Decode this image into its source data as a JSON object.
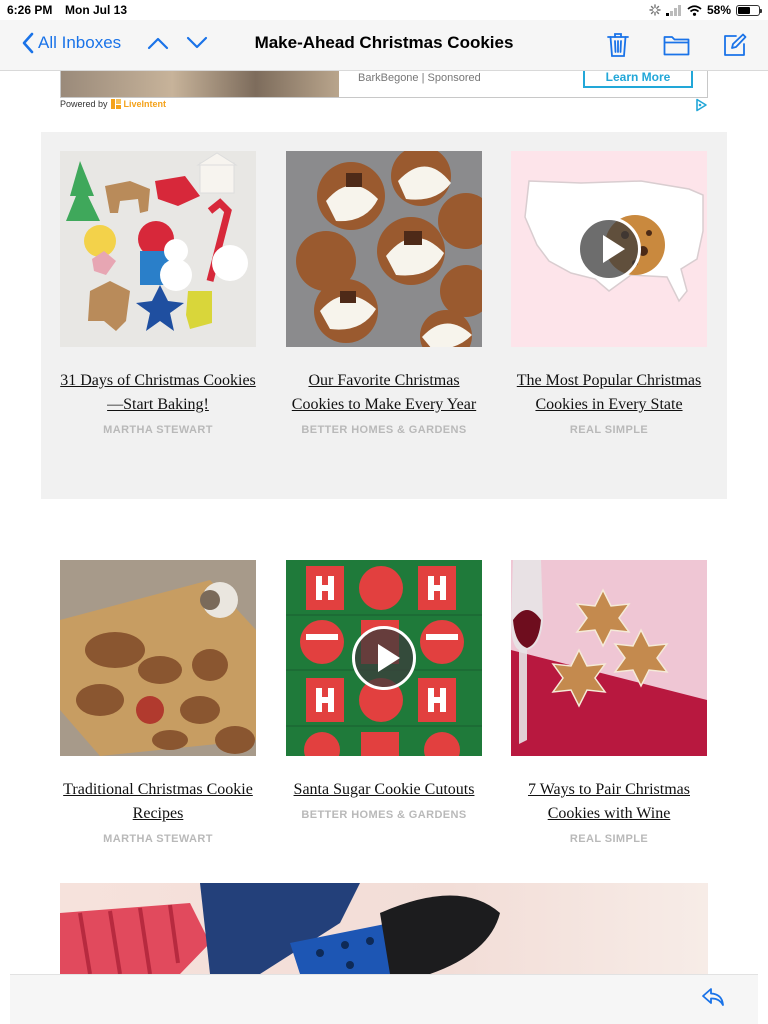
{
  "status": {
    "time": "6:26 PM",
    "date": "Mon Jul 13",
    "battery": "58%",
    "battery_level": 0.58
  },
  "nav": {
    "back_label": "All Inboxes",
    "title": "Make-Ahead Christmas Cookies",
    "icons": [
      "chevron-up-icon",
      "chevron-down-icon",
      "trash-icon",
      "folder-icon",
      "compose-icon"
    ]
  },
  "ad": {
    "sponsor": "BarkBegone | Sponsored",
    "cta": "Learn More",
    "powered_by": "Powered by",
    "powered_brand": "LiveIntent"
  },
  "cards": [
    {
      "title": "31 Days of Christmas Cookies—Start Baking!",
      "source": "MARTHA STEWART",
      "video": false
    },
    {
      "title": "Our Favorite Christmas Cookies to Make Every Year",
      "source": "BETTER HOMES & GARDENS",
      "video": false
    },
    {
      "title": "The Most Popular Christmas Cookies in Every State",
      "source": "REAL SIMPLE",
      "video": true
    },
    {
      "title": "Traditional Christmas Cookie Recipes",
      "source": "MARTHA STEWART",
      "video": false
    },
    {
      "title": "Santa Sugar Cookie Cutouts",
      "source": "BETTER HOMES & GARDENS",
      "video": true
    },
    {
      "title": "7 Ways to Pair Christmas Cookies with Wine",
      "source": "REAL SIMPLE",
      "video": false
    }
  ],
  "colors": {
    "accent": "#1a73e8",
    "ad_cta": "#22a7d8",
    "panel": "#f1f1f1",
    "source_text": "#b9b9b9"
  }
}
